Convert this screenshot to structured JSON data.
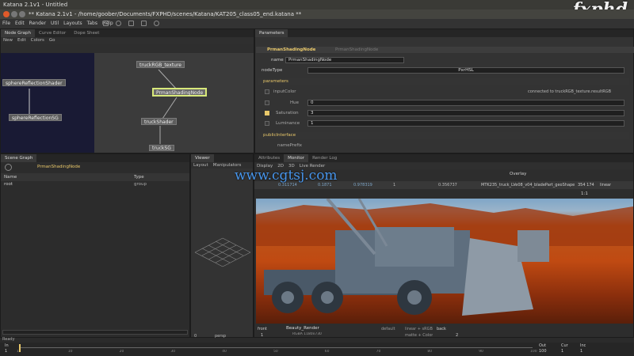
{
  "os_title": "Katana 2.1v1 - Untitled",
  "window_title": "** Katana 2.1v1 - /home/goober/Documents/FXPHD/scenes/Katana/KAT205_class05_end.katana **",
  "menus": [
    "File",
    "Edit",
    "Render",
    "Util",
    "Layouts",
    "Tabs",
    "Help"
  ],
  "watermark_logo": "fxphd",
  "watermark_cgtsj": "www.cgtsj.com",
  "node_graph": {
    "tabs": [
      "Node Graph",
      "Curve Editor",
      "Dope Sheet"
    ],
    "submenu": [
      "New",
      "Edit",
      "Colors",
      "Go"
    ],
    "nodes": [
      "truckRGB_texture",
      "PrmanShadingNode",
      "sphereReflectionShader",
      "sphereReflectionSG",
      "truckShader",
      "truckSG"
    ]
  },
  "parameters": {
    "tab": "Parameters",
    "node_title": "PrmanShadingNode",
    "node_sub": "PrmanShadingNode",
    "name_label": "name",
    "name_value": "PrmanShadingNode",
    "nodetype_label": "nodeType",
    "nodetype_value": "PxrHSL",
    "section_parameters": "parameters",
    "input_color_label": "inputColor",
    "input_color_connected": "connected to truckRGB_texture.resultRGB",
    "hue_label": "Hue",
    "hue_value": "0",
    "saturation_label": "Saturation",
    "saturation_value": "3",
    "luminance_label": "Luminance",
    "luminance_value": "1",
    "section_public": "publicInterface",
    "nameprefix_label": "namePrefix"
  },
  "scene_graph": {
    "tab": "Scene Graph",
    "node": "PrmanShadingNode",
    "col_name": "Name",
    "col_type": "Type",
    "row_name": "root",
    "row_type": "group"
  },
  "viewer": {
    "tab": "Viewer",
    "menus": [
      "Layout",
      "Manipulators"
    ],
    "camera": "persp",
    "value": "0"
  },
  "monitor": {
    "tabs": [
      "Attributes",
      "Monitor",
      "Render Log"
    ],
    "submenu": [
      "Display",
      "2D",
      "3D",
      "Live Render"
    ],
    "overlay_label": "Overlay",
    "ratio": "1:1",
    "pixel_values": [
      "0.311714",
      "0.1871",
      "0.978319",
      "1",
      "0.356737"
    ],
    "image_name": "MTK235_truck_LVe08_v04_bladePart_geoShape2",
    "coord": "354 174",
    "color_mode": "linear",
    "render_name": "Beauty_Render",
    "render_info": "RGBA  1180x730",
    "front_label": "front",
    "back_label": "back",
    "front_value": "1",
    "back_value": "2",
    "lut_a": "default",
    "lut_b": "linear + sRGB",
    "lut_c": "matte + Color"
  },
  "timeline": {
    "labels": [
      "In",
      "Out",
      "Cur",
      "Inc"
    ],
    "in_value": "1",
    "out_value": "100",
    "cur_value": "1",
    "inc_value": "1",
    "ticks": [
      "1",
      "10",
      "20",
      "30",
      "40",
      "50",
      "60",
      "70",
      "80",
      "90",
      "100"
    ]
  },
  "status": "Ready",
  "colors": {
    "accent_yellow": "#e9c86a",
    "node_selected": "#d8e87a",
    "sky": "#7fa6c8",
    "desert": "#c04a12"
  }
}
